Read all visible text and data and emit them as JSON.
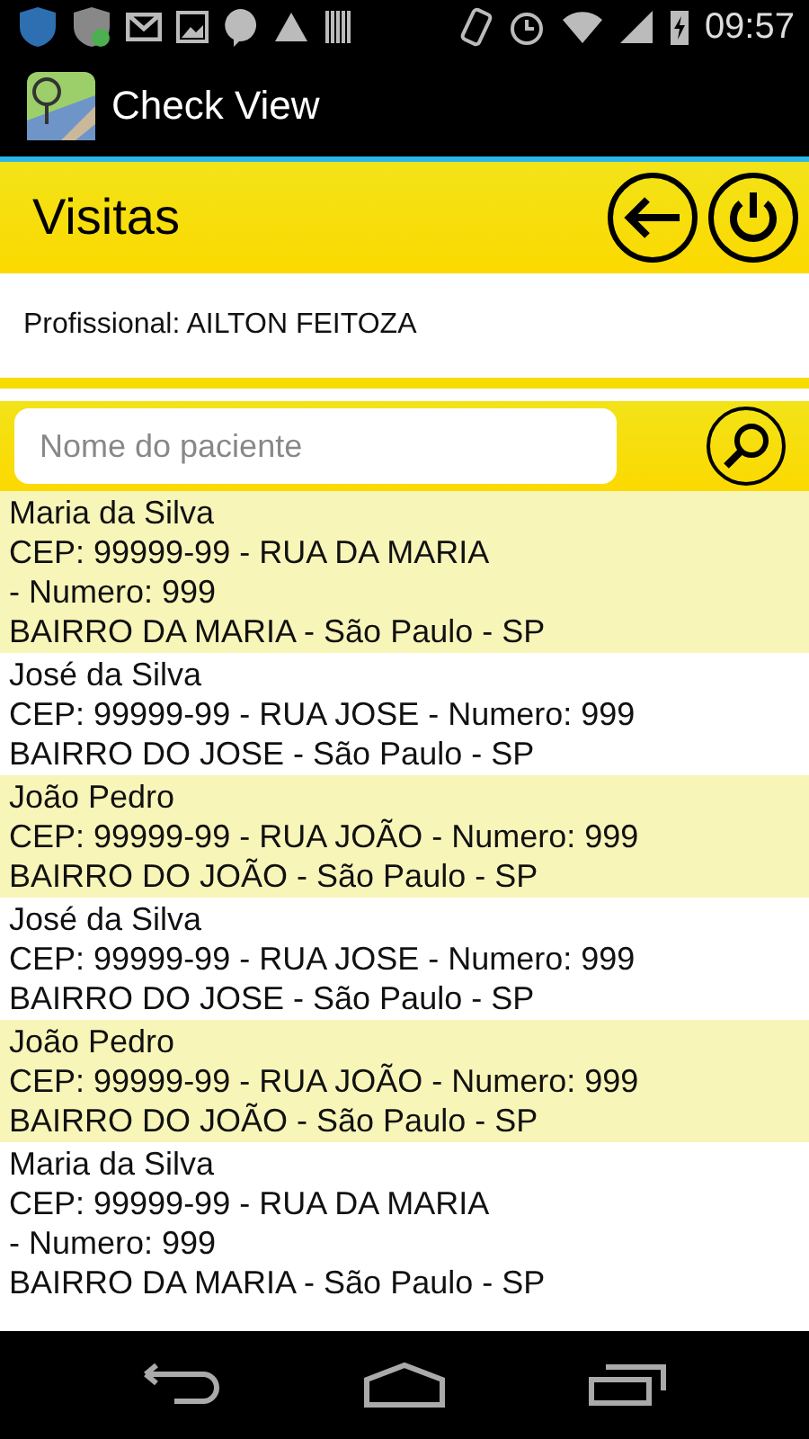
{
  "status_bar": {
    "time": "09:57"
  },
  "app_bar": {
    "title": "Check View"
  },
  "header": {
    "title": "Visitas"
  },
  "professional": {
    "text": "Profissional: AILTON FEITOZA"
  },
  "search": {
    "placeholder": "Nome do paciente"
  },
  "patients": [
    {
      "name": "Maria da Silva",
      "address_lines": [
        "CEP: 99999-99 - RUA DA MARIA",
        "- Numero: 999",
        "BAIRRO DA MARIA - São Paulo - SP"
      ],
      "shaded": true
    },
    {
      "name": "José da Silva",
      "address_lines": [
        "CEP: 99999-99 - RUA JOSE - Numero: 999",
        "BAIRRO DO JOSE - São Paulo - SP"
      ],
      "shaded": false
    },
    {
      "name": "João Pedro",
      "address_lines": [
        "CEP: 99999-99 - RUA JOÃO - Numero: 999",
        "BAIRRO DO JOÃO - São Paulo - SP"
      ],
      "shaded": true
    },
    {
      "name": "José da Silva",
      "address_lines": [
        "CEP: 99999-99 - RUA JOSE - Numero: 999",
        "BAIRRO DO JOSE - São Paulo - SP"
      ],
      "shaded": false
    },
    {
      "name": "João Pedro",
      "address_lines": [
        "CEP: 99999-99 - RUA JOÃO - Numero: 999",
        "BAIRRO DO JOÃO - São Paulo - SP"
      ],
      "shaded": true
    },
    {
      "name": "Maria da Silva",
      "address_lines": [
        "CEP: 99999-99 - RUA DA MARIA",
        "- Numero: 999",
        "BAIRRO DA MARIA - São Paulo - SP"
      ],
      "shaded": false
    }
  ]
}
